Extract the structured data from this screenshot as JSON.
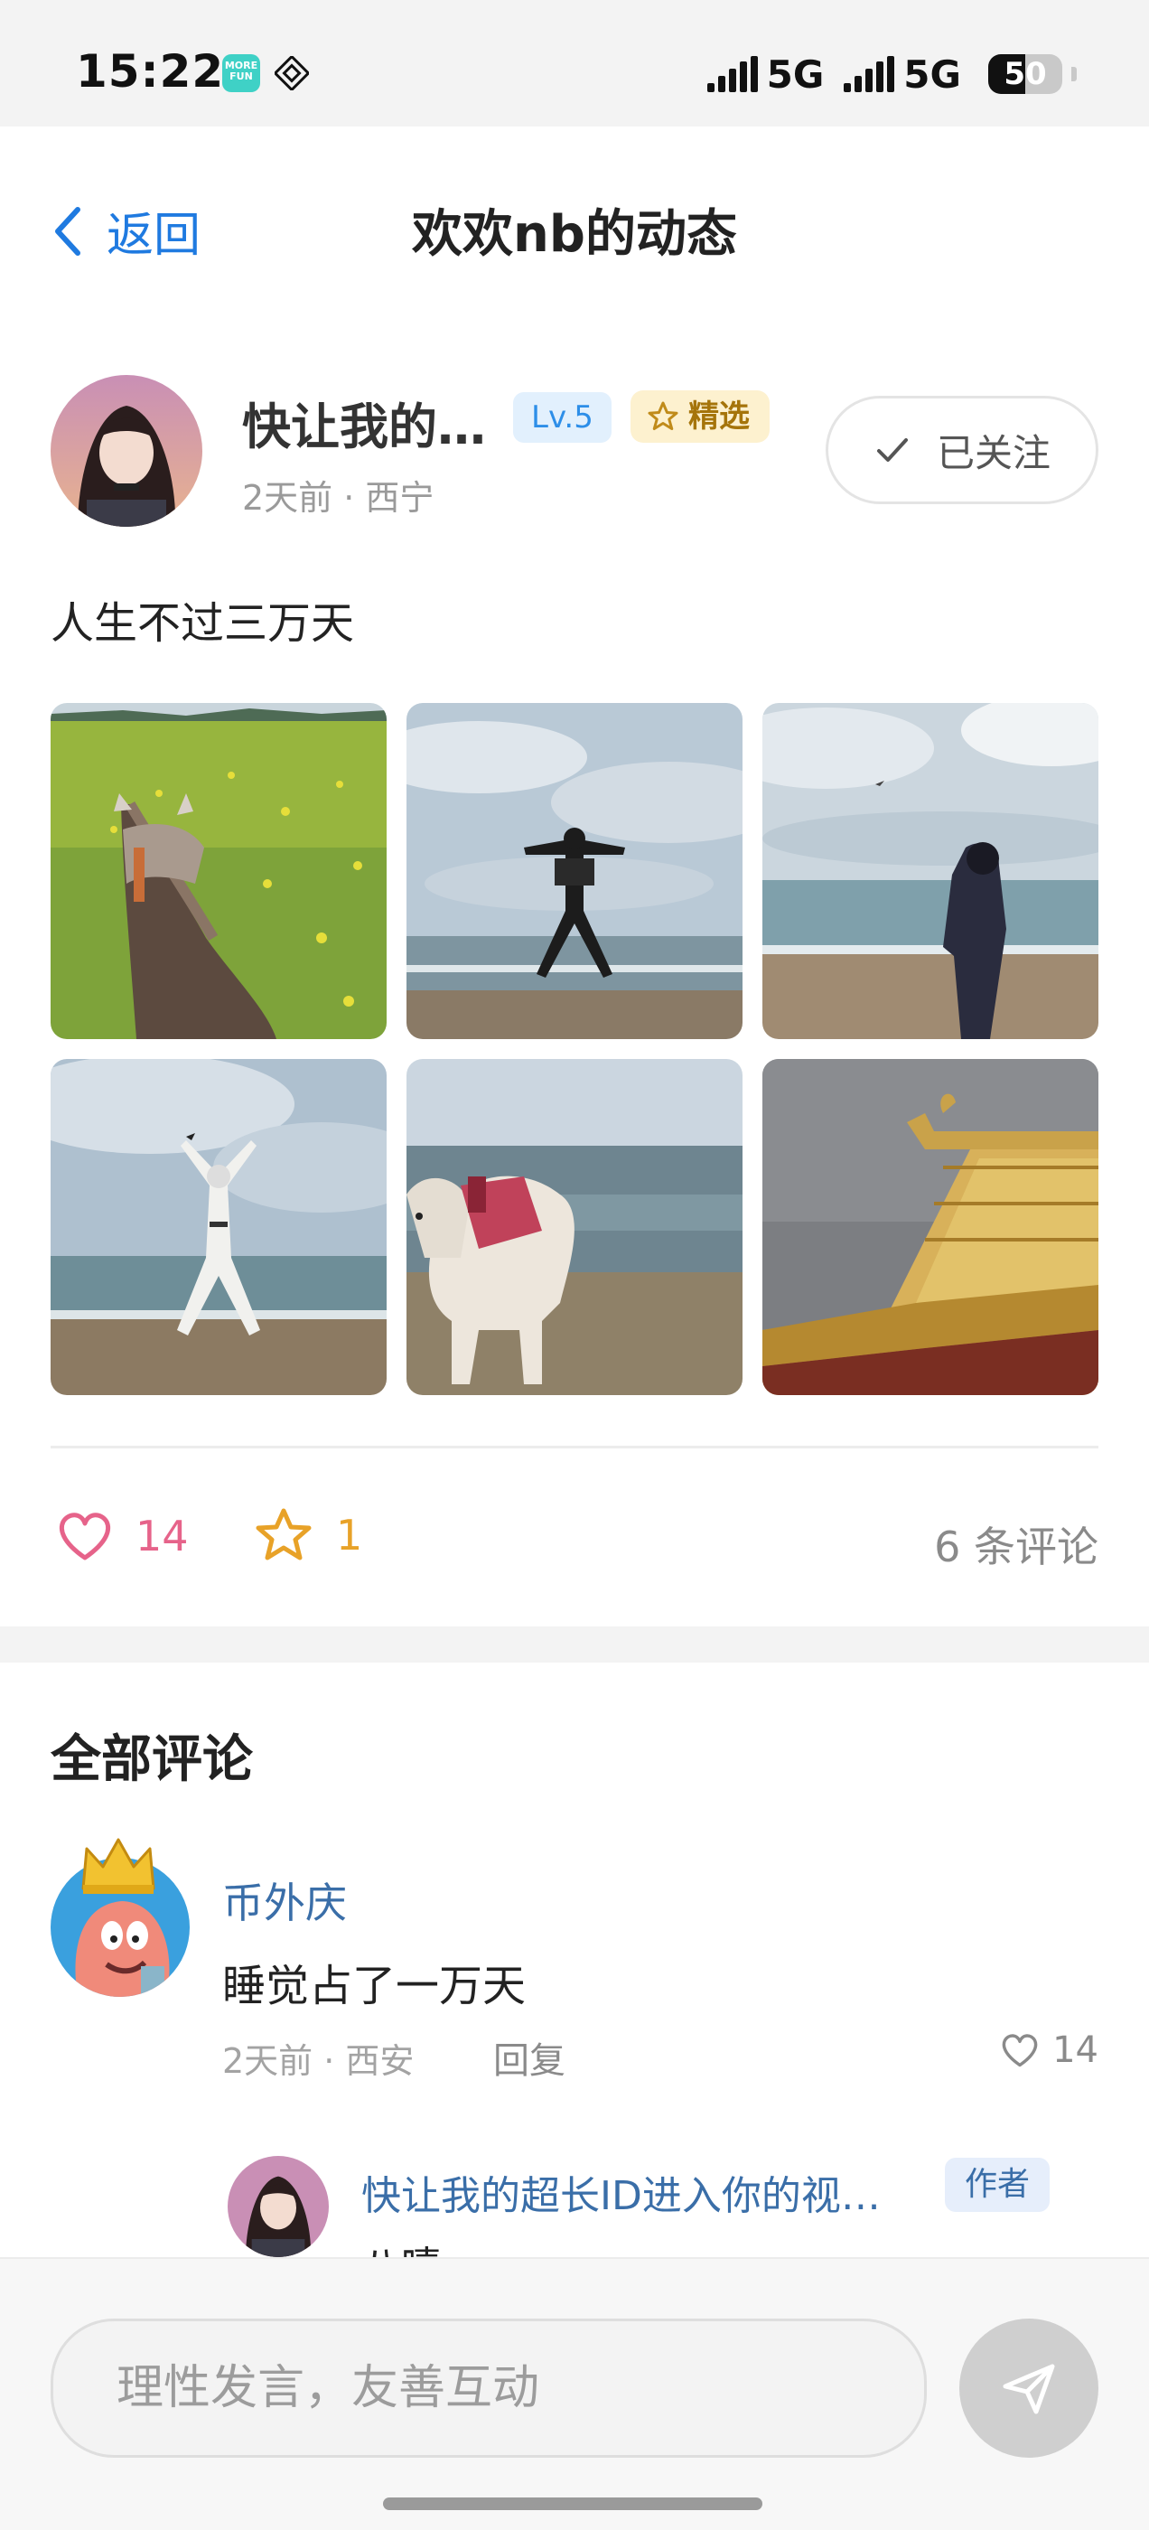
{
  "status_bar": {
    "time": "15:22",
    "app_icon_text": "MORE FUN",
    "network_1": "5G",
    "network_2": "5G",
    "battery_percent": 50,
    "battery_text": "50"
  },
  "header": {
    "back_label": "返回",
    "title": "欢欢nb的动态"
  },
  "post": {
    "author_name": "快让我的…",
    "level_badge": "Lv.5",
    "featured_badge": "精选",
    "time": "2天前",
    "location": "西宁",
    "meta": "2天前 · 西宁",
    "follow_label": "已关注",
    "text": "人生不过三万天",
    "photos": [
      "horse-ride-photo",
      "jumping-on-beach-photo",
      "standing-by-sea-photo",
      "arms-raised-photo",
      "yak-on-beach-photo",
      "golden-roof-photo"
    ],
    "likes": "14",
    "favorites": "1",
    "comment_count_label": "6 条评论"
  },
  "comments": {
    "title": "全部评论",
    "items": [
      {
        "user": "币外庆",
        "text": "睡觉占了一万天",
        "meta": "2天前 · 西安",
        "reply_label": "回复",
        "likes": "14",
        "replies": [
          {
            "user": "快让我的超长ID进入你的视…",
            "badge": "作者",
            "text": "八嘻"
          }
        ]
      }
    ]
  },
  "composer": {
    "placeholder": "理性发言，友善互动"
  },
  "colors": {
    "accent_blue": "#1f7ae0",
    "like_pink": "#e6638a",
    "favorite_orange": "#e8a228",
    "username_blue": "#3a6ea8"
  }
}
